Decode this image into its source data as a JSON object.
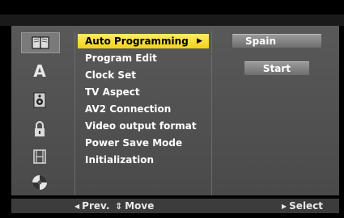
{
  "menu": {
    "items": [
      {
        "label": "Auto Programming"
      },
      {
        "label": "Program Edit"
      },
      {
        "label": "Clock Set"
      },
      {
        "label": "TV Aspect"
      },
      {
        "label": "AV2 Connection"
      },
      {
        "label": "Video output format"
      },
      {
        "label": "Power Save Mode"
      },
      {
        "label": "Initialization"
      }
    ],
    "selected_index": 0
  },
  "icons": [
    {
      "name": "setup-book-icon",
      "selected": true
    },
    {
      "name": "language-a-icon",
      "glyph": "A"
    },
    {
      "name": "speaker-icon"
    },
    {
      "name": "lock-icon"
    },
    {
      "name": "film-icon"
    },
    {
      "name": "disc-icon"
    }
  ],
  "options": {
    "country": "Spain",
    "start": "Start"
  },
  "footer": {
    "prev_label": "Prev.",
    "move_label": "Move",
    "select_label": "Select"
  },
  "colors": {
    "highlight": "#f3d21a",
    "panel": "#595959",
    "background": "#000000"
  }
}
